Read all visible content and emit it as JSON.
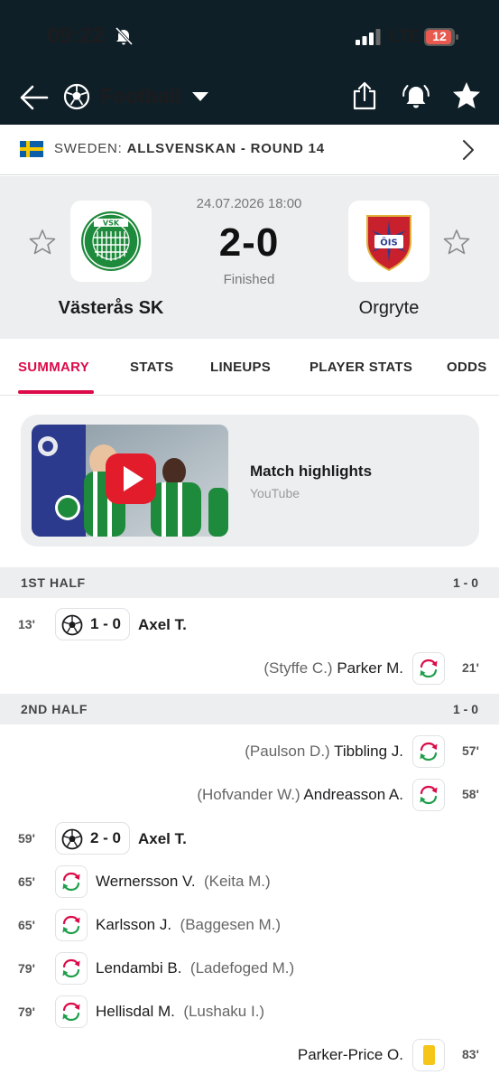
{
  "status_bar": {
    "time": "09:22",
    "network": "LTE",
    "battery": "12"
  },
  "nav": {
    "sport": "Football"
  },
  "league": {
    "country": "SWEDEN:",
    "competition": "ALLSVENSKAN - ROUND 14"
  },
  "match": {
    "date": "24.07.2026 18:00",
    "score": "2-0",
    "status": "Finished",
    "home": {
      "name": "Västerås SK"
    },
    "away": {
      "name": "Orgryte"
    }
  },
  "tabs": [
    {
      "label": "SUMMARY",
      "active": true
    },
    {
      "label": "STATS"
    },
    {
      "label": "LINEUPS"
    },
    {
      "label": "PLAYER STATS"
    },
    {
      "label": "ODDS"
    }
  ],
  "highlights": {
    "title": "Match highlights",
    "source": "YouTube"
  },
  "halves": [
    {
      "label": "1ST HALF",
      "score": "1 - 0"
    },
    {
      "label": "2ND HALF",
      "score": "1 - 0"
    }
  ],
  "events": {
    "e1": {
      "minute": "13'",
      "score": "1 - 0",
      "player": "Axel T."
    },
    "e2": {
      "minute": "21'",
      "out": "(Styffe C.)",
      "in": "Parker M."
    },
    "e3": {
      "minute": "57'",
      "out": "(Paulson D.)",
      "in": "Tibbling J."
    },
    "e4": {
      "minute": "58'",
      "out": "(Hofvander W.)",
      "in": "Andreasson A."
    },
    "e5": {
      "minute": "59'",
      "score": "2 - 0",
      "player": "Axel T."
    },
    "e6": {
      "minute": "65'",
      "in": "Wernersson V.",
      "out": "(Keita M.)"
    },
    "e7": {
      "minute": "65'",
      "in": "Karlsson J.",
      "out": "(Baggesen M.)"
    },
    "e8": {
      "minute": "79'",
      "in": "Lendambi B.",
      "out": "(Ladefoged M.)"
    },
    "e9": {
      "minute": "79'",
      "in": "Hellisdal M.",
      "out": "(Lushaku I.)"
    },
    "e10": {
      "minute": "83'",
      "player": "Parker-Price O."
    }
  },
  "colors": {
    "header_bg": "#0f1f27",
    "accent": "#dc0a48",
    "sub_green": "#1e9e4a",
    "sub_red": "#dc0a48",
    "yellow_card": "#f5c518"
  }
}
